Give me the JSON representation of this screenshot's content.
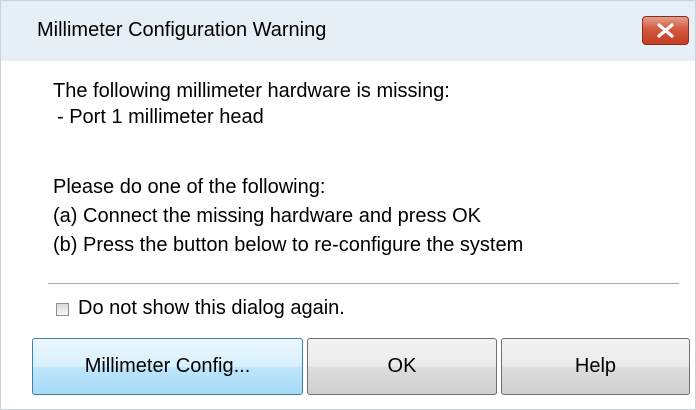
{
  "window": {
    "title": "Millimeter Configuration Warning",
    "close_icon": "close-icon"
  },
  "message": {
    "line1": "The following millimeter hardware is missing:",
    "line2": "- Port 1 millimeter head",
    "line3": "Please do one of the following:",
    "line4": "(a) Connect the missing hardware and press OK",
    "line5": "(b) Press the button below to re-configure the system"
  },
  "checkbox": {
    "label": "Do not show this dialog again.",
    "checked": false
  },
  "buttons": {
    "millimeter_config": "Millimeter Config...",
    "ok": "OK",
    "help": "Help"
  },
  "colors": {
    "titlebar": "#e6eef6",
    "close_button": "#c94a30",
    "primary_button_border": "#3c7fb1"
  }
}
